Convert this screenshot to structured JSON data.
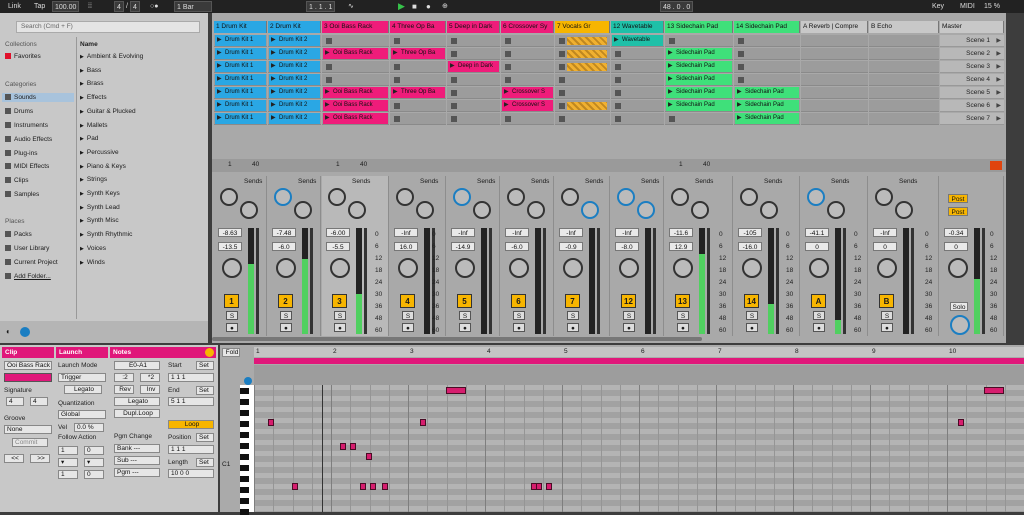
{
  "topbar": {
    "link": "Link",
    "tap": "Tap",
    "tempo": "100.00",
    "sig_num": "4",
    "sig_den": "4",
    "quant": "1 Bar",
    "position": "1 . 1 . 1",
    "loop_end": "48 . 0 . 0",
    "key": "Key",
    "midi": "MIDI",
    "cpu": "15 %"
  },
  "browser": {
    "search_placeholder": "Search (Cmd + F)",
    "collections_header": "Collections",
    "favorites": "Favorites",
    "categories_header": "Categories",
    "categories": [
      "Sounds",
      "Drums",
      "Instruments",
      "Audio Effects",
      "Plug-ins",
      "MIDI Effects",
      "Clips",
      "Samples"
    ],
    "places_header": "Places",
    "places": [
      "Packs",
      "User Library",
      "Current Project",
      "Add Folder..."
    ],
    "name_header": "Name",
    "names": [
      "Ambient & Evolving",
      "Bass",
      "Brass",
      "Effects",
      "Guitar & Plucked",
      "Mallets",
      "Pad",
      "Percussive",
      "Piano & Keys",
      "Strings",
      "Synth Keys",
      "Synth Lead",
      "Synth Misc",
      "Synth Rhythmic",
      "Voices",
      "Winds"
    ]
  },
  "tracks": [
    {
      "name": "1 Drum Kit",
      "color": "#2aa7e4"
    },
    {
      "name": "2 Drum Kit",
      "color": "#2aa7e4"
    },
    {
      "name": "3 Ooi Bass Rack",
      "color": "#ef1c7a"
    },
    {
      "name": "4 Three Op Ba",
      "color": "#ef1c7a"
    },
    {
      "name": "5 Deep in Dark",
      "color": "#ef1c7a"
    },
    {
      "name": "6 Crossover Sy",
      "color": "#ef1c7a"
    },
    {
      "name": "7 Vocals Gr",
      "color": "#f7b500"
    },
    {
      "name": "12 Wavetable",
      "color": "#1fc0a8"
    },
    {
      "name": "13 Sidechain Pad",
      "color": "#3fe07a"
    },
    {
      "name": "14 Sidechain Pad",
      "color": "#3fe07a"
    },
    {
      "name": "A Reverb | Compre",
      "color": "#c8c8c8"
    },
    {
      "name": "B Echo",
      "color": "#c8c8c8"
    }
  ],
  "master": {
    "name": "Master",
    "scenes": [
      "Scene 1",
      "Scene 2",
      "Scene 3",
      "Scene 4",
      "Scene 5",
      "Scene 6",
      "Scene 7"
    ]
  },
  "clips": {
    "drum1": [
      "Drum Kit 1",
      "Drum Kit 1",
      "Drum Kit 1",
      "Drum Kit 1",
      "Drum Kit 1",
      "Drum Kit 1",
      "Drum Kit 1"
    ],
    "drum2": [
      "Drum Kit 2",
      "Drum Kit 2",
      "Drum Kit 2",
      "Drum Kit 2",
      "Drum Kit 2",
      "Drum Kit 2",
      "Drum Kit 2"
    ],
    "bass": [
      "Ooi Bass Rack",
      "Ooi Bass Rack",
      "Ooi Bass Rack",
      "Ooi Bass Rack"
    ],
    "three_op": [
      "Three Op Ba",
      "Three Op Ba"
    ],
    "deep": "Deep in Dark",
    "cross": [
      "Crossover S",
      "Crossover S"
    ],
    "wave": "Wavetable",
    "side13": [
      "Sidechain Pad",
      "Sidechain Pad",
      "Sidechain Pad",
      "Sidechain Pad",
      "Sidechain Pad"
    ],
    "side14": [
      "Sidechain Pad",
      "Sidechain Pad",
      "Sidechain Pad"
    ]
  },
  "mixer": {
    "sends_label": "Sends",
    "io_a_1": "1",
    "io_a_2": "40",
    "io_b_1": "1",
    "io_b_2": "40",
    "io_c_1": "1",
    "io_c_2": "40",
    "vol_values": [
      "-8.63",
      "-7.48",
      "-6.00",
      "-Inf",
      "-Inf",
      "-Inf",
      "-Inf",
      "-Inf",
      "-11.6",
      "-105",
      "-41.1",
      "-Inf",
      "-0.34"
    ],
    "peak_values": [
      "-13.5",
      "-6.0",
      "-5.5",
      "16.0",
      "-14.9",
      "-6.0",
      "-0.9",
      "-8.0",
      "12.9",
      "-16.0",
      "0",
      "0",
      "0"
    ],
    "numbers": [
      "1",
      "2",
      "3",
      "4",
      "5",
      "6",
      "7",
      "12",
      "13",
      "14",
      "A",
      "B"
    ],
    "solo": "S",
    "post_label": "Post",
    "solo_master": "Solo",
    "db_scale": [
      "0",
      "6",
      "12",
      "18",
      "24",
      "30",
      "36",
      "48",
      "60"
    ]
  },
  "clipview": {
    "clip_header": "Clip",
    "launch_header": "Launch",
    "notes_header": "Notes",
    "clip_name": "Ooi Bass Rack",
    "signature_label": "Signature",
    "sig_num": "4",
    "sig_den": "4",
    "groove_label": "Groove",
    "groove_value": "None",
    "commit": "Commit",
    "launch_mode_label": "Launch Mode",
    "launch_mode": "Trigger",
    "legato": "Legato",
    "quantization_label": "Quantization",
    "quantization": "Global",
    "vel_label": "Vel",
    "vel_value": "0.0 %",
    "follow_label": "Follow Action",
    "follow_a": "1",
    "follow_b": "0",
    "follow_c": "1",
    "follow_d": "0",
    "range": "E0-A1",
    "half": ":2",
    "dbl": "*2",
    "rev": "Rev",
    "inv": "Inv",
    "legato2": "Legato",
    "dupl_loop": "Dupl.Loop",
    "pgm_label": "Pgm Change",
    "bank": "Bank ---",
    "sub": "Sub ---",
    "pgm": "Pgm ---",
    "start_label": "Start",
    "set": "Set",
    "start_val": "1    1    1",
    "end_label": "End",
    "end_val": "5    1    1",
    "loop": "Loop",
    "position_label": "Position",
    "position_val": "1    1    1",
    "length_label": "Length",
    "length_val": "10    0    0"
  },
  "pianoroll": {
    "fold": "Fold",
    "c1": "C1",
    "bars": [
      "1",
      "2",
      "3",
      "4",
      "5",
      "6",
      "7",
      "8",
      "9",
      "10"
    ]
  }
}
